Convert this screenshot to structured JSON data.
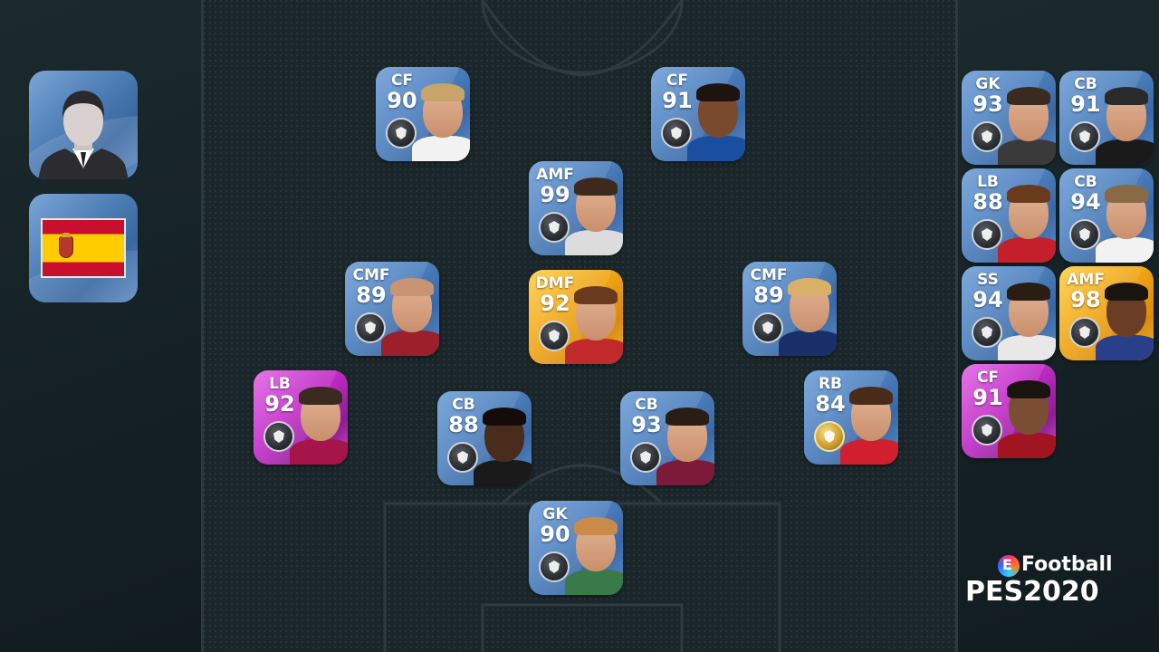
{
  "manager": {
    "name": "manager-avatar"
  },
  "nationality": {
    "country": "Spain",
    "colors": [
      "#c8102e",
      "#ffcc00"
    ]
  },
  "lineup": [
    {
      "id": "st-left",
      "pos": "CF",
      "rating": "90",
      "type": "standard",
      "hair": "#c9a46a",
      "shirt": "#f2f2f2"
    },
    {
      "id": "st-right",
      "pos": "CF",
      "rating": "91",
      "type": "standard",
      "hair": "#1d1410",
      "shirt": "#1a4fa0",
      "skin": "#7a4a2e"
    },
    {
      "id": "amf",
      "pos": "AMF",
      "rating": "99",
      "type": "standard",
      "hair": "#3d2a1c",
      "shirt": "#dcdcdc"
    },
    {
      "id": "cmf-left",
      "pos": "CMF",
      "rating": "89",
      "type": "standard",
      "hair": "#c89474",
      "shirt": "#9c1f2b"
    },
    {
      "id": "dmf",
      "pos": "DMF",
      "rating": "92",
      "type": "gold",
      "hair": "#6a3a1e",
      "shirt": "#c02a2a"
    },
    {
      "id": "cmf-right",
      "pos": "CMF",
      "rating": "89",
      "type": "standard",
      "hair": "#d9b06a",
      "shirt": "#1a2f6a"
    },
    {
      "id": "lb",
      "pos": "LB",
      "rating": "92",
      "type": "legend",
      "hair": "#3b2a20",
      "shirt": "#a5154a"
    },
    {
      "id": "cb-left",
      "pos": "CB",
      "rating": "88",
      "type": "standard",
      "hair": "#140c08",
      "shirt": "#1a1a1a",
      "skin": "#4a2c1c"
    },
    {
      "id": "cb-right",
      "pos": "CB",
      "rating": "93",
      "type": "standard",
      "hair": "#2a1d14",
      "shirt": "#7d1a3a"
    },
    {
      "id": "rb",
      "pos": "RB",
      "rating": "84",
      "type": "standard",
      "hair": "#4a2b18",
      "shirt": "#d11f2f",
      "goldLevel": true
    },
    {
      "id": "gk",
      "pos": "GK",
      "rating": "90",
      "type": "standard",
      "hair": "#c98a4a",
      "shirt": "#3a7a4a"
    }
  ],
  "reserves": [
    {
      "id": "res-1",
      "pos": "GK",
      "rating": "93",
      "type": "standard",
      "hair": "#3b2a20",
      "shirt": "#3a3a3a"
    },
    {
      "id": "res-2",
      "pos": "CB",
      "rating": "91",
      "type": "standard",
      "hair": "#2a2a2a",
      "shirt": "#1a1a1a"
    },
    {
      "id": "res-3",
      "pos": "LB",
      "rating": "88",
      "type": "standard",
      "hair": "#6a3a1c",
      "shirt": "#c41f2a"
    },
    {
      "id": "res-4",
      "pos": "CB",
      "rating": "94",
      "type": "standard",
      "hair": "#8a6a44",
      "shirt": "#f2f2f2"
    },
    {
      "id": "res-5",
      "pos": "SS",
      "rating": "94",
      "type": "standard",
      "hair": "#2a1d14",
      "shirt": "#e8e8e8"
    },
    {
      "id": "res-6",
      "pos": "AMF",
      "rating": "98",
      "type": "gold",
      "hair": "#1a1410",
      "shirt": "#2a3f8a",
      "skin": "#6a3e24"
    },
    {
      "id": "res-7",
      "pos": "CF",
      "rating": "91",
      "type": "legend",
      "hair": "#1a1410",
      "shirt": "#a0151f",
      "skin": "#7a4e32"
    }
  ],
  "logo": {
    "brand": "Football",
    "title": "PES2020"
  }
}
